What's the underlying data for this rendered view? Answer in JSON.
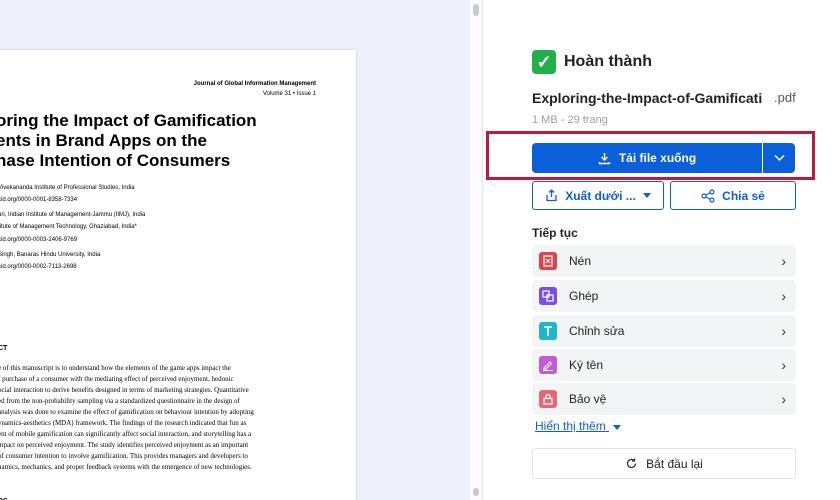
{
  "document": {
    "journal": "Journal of Global Information Management",
    "volume": "Volume 31 • Issue 1",
    "title_lines": [
      "oring the Impact of Gamification",
      "ents in Brand Apps on the",
      "hase Intention of Consumers"
    ],
    "authors": [
      "Vivekananda Institute of Professional Studies, India",
      "cid.org/0000-0001-8358-7334",
      "uri, Indian Institute of Management-Jammu (IIMJ), India",
      "titute of Management Technology, Ghaziabad, India*",
      "cid.org/0000-0003-2406-9769",
      "Singh, Banaras Hindu University, India",
      "cid.org/0000-0002-7113-2698"
    ],
    "abstract_heading": "CT",
    "abstract_lines": [
      "e of this manuscript is to understand how the elements of the game apps impact the",
      "f purchase of a consumer with the mediating effect of perceived enjoyment, hedonic",
      "ocial interaction to derive benefits designed in terms of marketing strategies. Quantitative",
      "ed from the non-probability sampling via a standardized questionnaire in the design of",
      "analysis was done to examine the effect of gamification on behaviour intention by adopting",
      "ynamics-aesthetics (MDA) framework. The findings of the research indicated that fun as",
      "ent of mobile gamification can significantly affect social interaction, and storytelling has a",
      "mpact on perceived enjoyment. The study identifies perceived enjoyment as an important",
      "of consumer intention to involve gamification. This provides managers and developers to",
      "namics, mechanics, and proper feedback systems with the emergence of new technologies."
    ],
    "keywords_heading": "DS"
  },
  "panel": {
    "status_label": "Hoàn thành",
    "file_name": "Exploring-the-Impact-of-Gamificati...",
    "file_ext": ".pdf",
    "file_meta": "1 MB - 29 trang",
    "download_label": "Tải file xuống",
    "export_label": "Xuất dưới ...",
    "share_label": "Chia sẻ",
    "continue_heading": "Tiếp tục",
    "tools": [
      {
        "label": "Nén",
        "icon": "compress-icon",
        "color": "#e0434b"
      },
      {
        "label": "Ghép",
        "icon": "merge-icon",
        "color": "#7a4fe0"
      },
      {
        "label": "Chỉnh sửa",
        "icon": "edit-text-icon",
        "color": "#1eb7c8"
      },
      {
        "label": "Ký tên",
        "icon": "sign-icon",
        "color": "#c25bd6"
      },
      {
        "label": "Bảo vệ",
        "icon": "lock-icon",
        "color": "#e26a76"
      }
    ],
    "show_more_label": "Hiển thị thêm",
    "restart_label": "Bắt đầu lại"
  },
  "colors": {
    "accent": "#0b5fd8",
    "success": "#22b04b",
    "highlight": "#c2183a"
  }
}
